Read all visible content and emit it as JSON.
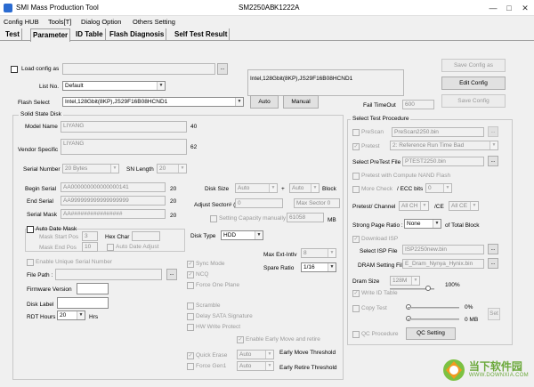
{
  "window": {
    "title": "SMI Mass Production Tool",
    "model": "SM2250AB",
    "version": "K1222A",
    "minimize": "—",
    "maximize": "□",
    "close": "✕"
  },
  "menu": [
    "Config HUB",
    "Tools[T]",
    "Dialog Option",
    "Others Setting"
  ],
  "tabs": [
    "Test",
    "Parameter",
    "ID Table",
    "Flash Diagnosis",
    "Self Test Result"
  ],
  "top": {
    "load_config_label": "Load config as",
    "load_config_value": "",
    "browse": "...",
    "save_config_as": "Save Config as",
    "edit_config": "Edit Config",
    "save_config": "Save Config",
    "list_no_label": "List No.",
    "list_no_value": "Default",
    "flash_info": "Intel,128Gbit(8KP),JS29F16B08HCND1",
    "flash_select_label": "Flash Select",
    "flash_select_value": "Intel,128Gbit(8KP),JS29F16B08HCND1",
    "auto_btn": "Auto",
    "manual_btn": "Manual",
    "fail_timeout_label": "Fail TimeOut",
    "fail_timeout_value": "600"
  },
  "ssd": {
    "group_title": "Solid State Disk",
    "model_name_label": "Model Name",
    "model_name_value": "LIYANG",
    "model_name_len": "40",
    "vendor_specific_label": "Vendor Specific",
    "vendor_specific_value": "LIYANG",
    "vendor_specific_len": "62",
    "serial_number_label": "Serial Number",
    "serial_number_value": "20 Bytes",
    "sn_length_label": "SN Length",
    "sn_length_value": "20",
    "begin_serial_label": "Begin Serial",
    "begin_serial_value": "AA000000000000000141",
    "begin_serial_len": "20",
    "end_serial_label": "End Serial",
    "end_serial_value": "AA999999999999999999",
    "end_serial_len": "20",
    "serial_mask_label": "Serial Mask",
    "serial_mask_value": "AA################",
    "serial_mask_len": "20",
    "disk_size_label": "Disk Size",
    "disk_size_value": "Auto",
    "plus": "+",
    "disk_size_value2": "Auto",
    "block": "Block",
    "adjust_sector_label": "Adjust Sector# (-)",
    "adjust_sector_value": "0",
    "max_sector_value": "Max Sector 0",
    "setting_capacity_label": "Setting Capacity manually",
    "setting_capacity_value": "61058",
    "mb": "MB",
    "auto_date_mask_label": "Auto Date Mask",
    "mask_start_pos_label": "Mask Start Pos",
    "mask_start_pos_value": "3",
    "hex_char_label": "Hex Char",
    "mask_end_pos_label": "Mask End Pos",
    "mask_end_pos_value": "10",
    "auto_date_adjust_label": "Auto Date Adjust",
    "disk_type_label": "Disk Type",
    "disk_type_value": "HDD",
    "max_ext_intlv_label": "Max Ext-Intlv",
    "max_ext_intlv_value": "8",
    "spare_ratio_label": "Spare Ratio",
    "spare_ratio_value": "1/16",
    "enable_unique_serial_label": "Enable Unique Serial Number",
    "file_path_label": "File Path :",
    "firmware_version_label": "Firmware Version",
    "disk_label_label": "Disk Label",
    "rdt_hours_label": "RDT Hours",
    "rdt_hours_value": "20",
    "hrs": "Hrs",
    "sync_mode_label": "Sync Mode",
    "ncq_label": "NCQ",
    "force_one_plane_label": "Force One Plane",
    "scramble_label": "Scramble",
    "delay_sata_signature_label": "Delay SATA Signature",
    "hw_write_protect_label": "HW Write Protect",
    "enable_early_move_label": "Enable Early Move and retire",
    "quick_erase_label": "Quick Erase",
    "quick_erase_value": "Auto",
    "early_move_threshold_label": "Early Move Threshold",
    "force_gen1_label": "Force Gen1",
    "force_gen1_value": "Auto",
    "early_retire_threshold_label": "Early Retire Threshold"
  },
  "select_test": {
    "group_title": "Select Test Procedure",
    "prescan_label": "PreScan",
    "prescan_value": "PreScan2250.bin",
    "pretest_label": "Pretest",
    "pretest_value": "2: Reference Run Time Bad",
    "select_pretest_file_label": "Select PreTest File",
    "select_pretest_file_value": "PTEST2250.bin",
    "pretest_compute_label": "Pretest with Compute NAND Flash",
    "more_check_label": "More Check",
    "ecc_bits_label": "/ ECC bits",
    "ecc_bits_value": "0",
    "pretest_channel_label": "Pretest/ Channel",
    "pretest_channel_value": "All CH",
    "ce_label": "/CE",
    "ce_value": "All CE",
    "strong_page_ratio_label": "Strong Page Ratio :",
    "strong_page_ratio_value": "None",
    "of_total_block": "of Total Block",
    "download_isp_label": "Download ISP",
    "select_isp_file_label": "Select ISP File",
    "select_isp_file_value": "ISP2250new.bin",
    "dram_setting_file_label": "DRAM Setting File",
    "dram_setting_file_value": "E_Dram_Nynya_Hynix.bin",
    "dram_size_label": "Dram Size",
    "dram_size_value": "128M",
    "dram_percent": "100%",
    "write_id_table_label": "Write ID Table",
    "copy_test_label": "Copy Test",
    "copy_percent": "0%",
    "copy_mb": "0 MB",
    "set_btn": "Set",
    "qc_procedure_label": "QC Procedure",
    "qc_setting_btn": "QC Setting"
  },
  "watermark": {
    "title": "当下软件园",
    "url": "WWW.DOWNXIA.COM"
  },
  "colors": {
    "accent": "#0b5ed7",
    "watermark_green": "#7cc142",
    "watermark_orange": "#f39a1e"
  }
}
